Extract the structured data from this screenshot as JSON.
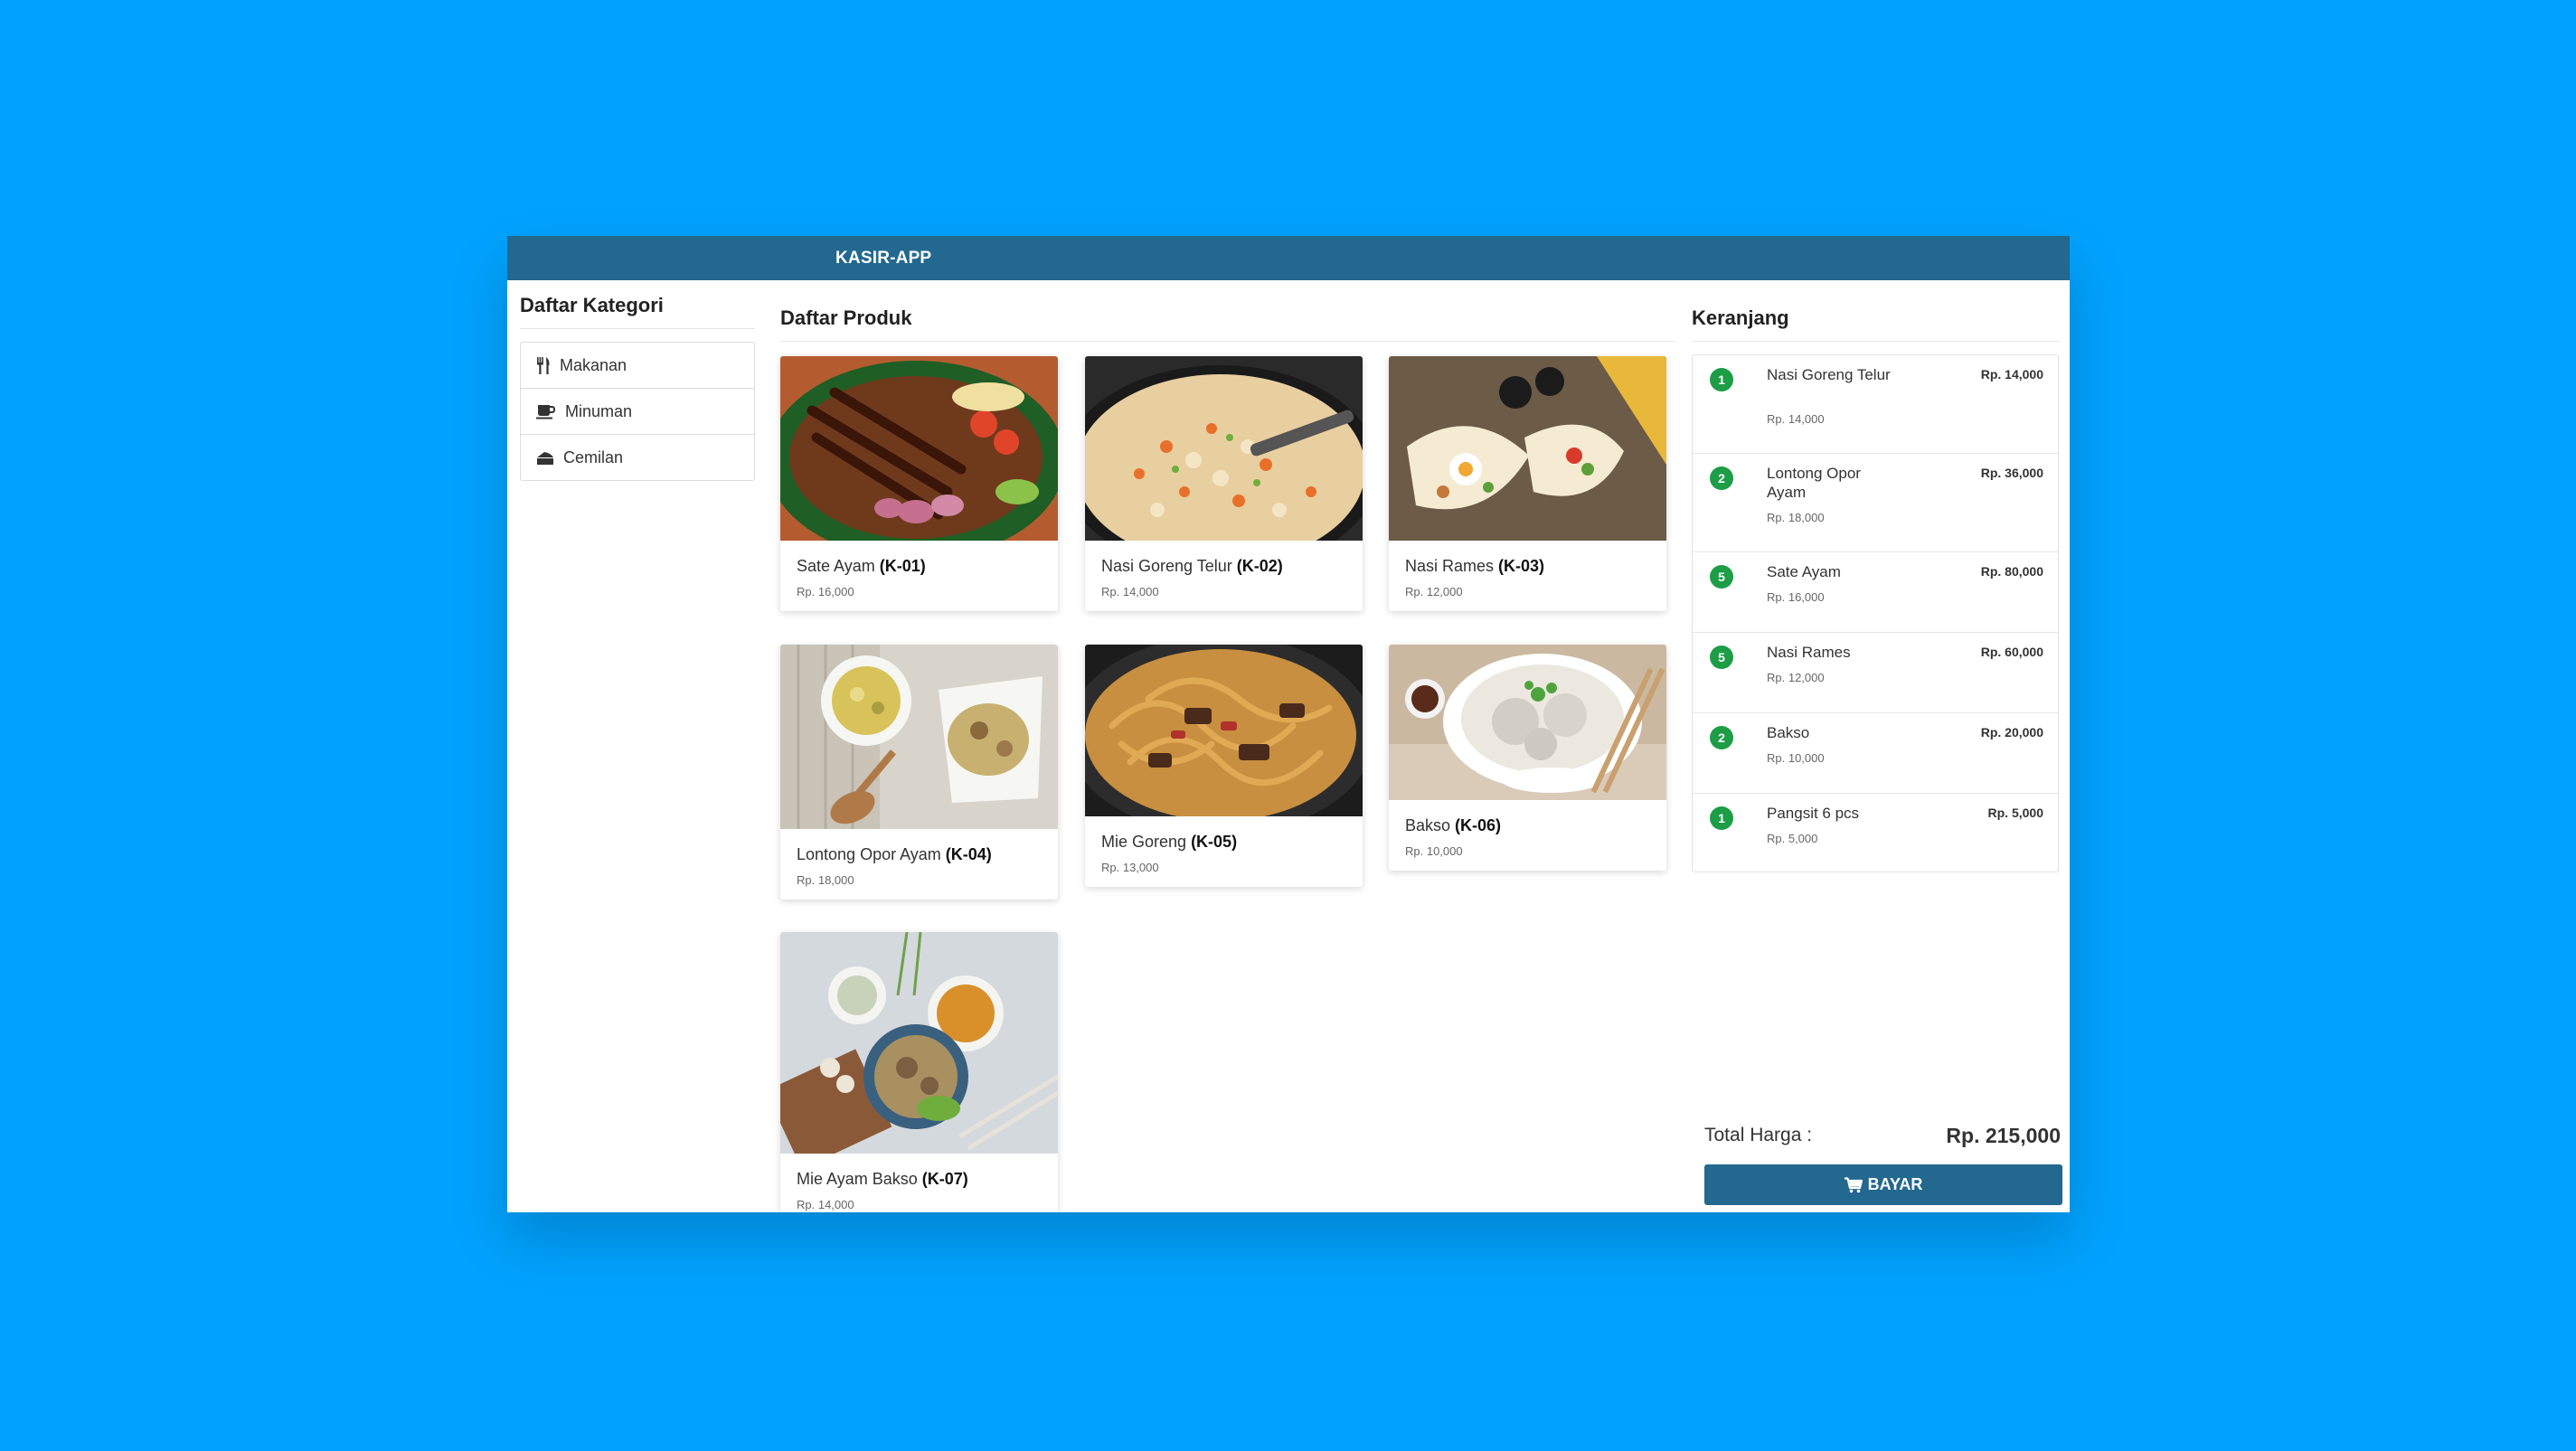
{
  "app": {
    "brand": "KASIR-APP"
  },
  "sidebar": {
    "title": "Daftar Kategori",
    "categories": [
      {
        "label": "Makanan",
        "icon": "utensils-icon"
      },
      {
        "label": "Minuman",
        "icon": "coffee-icon"
      },
      {
        "label": "Cemilan",
        "icon": "cheese-icon"
      }
    ]
  },
  "products": {
    "title": "Daftar Produk",
    "items": [
      {
        "name": "Sate Ayam",
        "code": "(K-01)",
        "price": "Rp. 16,000"
      },
      {
        "name": "Nasi Goreng Telur",
        "code": "(K-02)",
        "price": "Rp. 14,000"
      },
      {
        "name": "Nasi Rames",
        "code": "(K-03)",
        "price": "Rp. 12,000"
      },
      {
        "name": "Lontong Opor Ayam",
        "code": "(K-04)",
        "price": "Rp. 18,000"
      },
      {
        "name": "Mie Goreng",
        "code": "(K-05)",
        "price": "Rp. 13,000"
      },
      {
        "name": "Bakso",
        "code": "(K-06)",
        "price": "Rp. 10,000"
      },
      {
        "name": "Mie Ayam Bakso",
        "code": "(K-07)",
        "price": "Rp. 14,000"
      }
    ]
  },
  "cart": {
    "title": "Keranjang",
    "items": [
      {
        "qty": "1",
        "name": "Nasi Goreng Telur",
        "unit_price": "Rp. 14,000",
        "total": "Rp. 14,000"
      },
      {
        "qty": "2",
        "name": "Lontong Opor Ayam",
        "unit_price": "Rp. 18,000",
        "total": "Rp. 36,000"
      },
      {
        "qty": "5",
        "name": "Sate Ayam",
        "unit_price": "Rp. 16,000",
        "total": "Rp. 80,000"
      },
      {
        "qty": "5",
        "name": "Nasi Rames",
        "unit_price": "Rp. 12,000",
        "total": "Rp. 60,000"
      },
      {
        "qty": "2",
        "name": "Bakso",
        "unit_price": "Rp. 10,000",
        "total": "Rp. 20,000"
      },
      {
        "qty": "1",
        "name": "Pangsit 6 pcs",
        "unit_price": "Rp. 5,000",
        "total": "Rp. 5,000"
      }
    ],
    "total_label": "Total Harga :",
    "total_value": "Rp. 215,000",
    "pay_label": "BAYAR",
    "pay_icon": "cart-icon"
  },
  "colors": {
    "background": "#01a2fe",
    "navbar": "#22688f",
    "badge": "#1c9d46",
    "button": "#22688f"
  }
}
